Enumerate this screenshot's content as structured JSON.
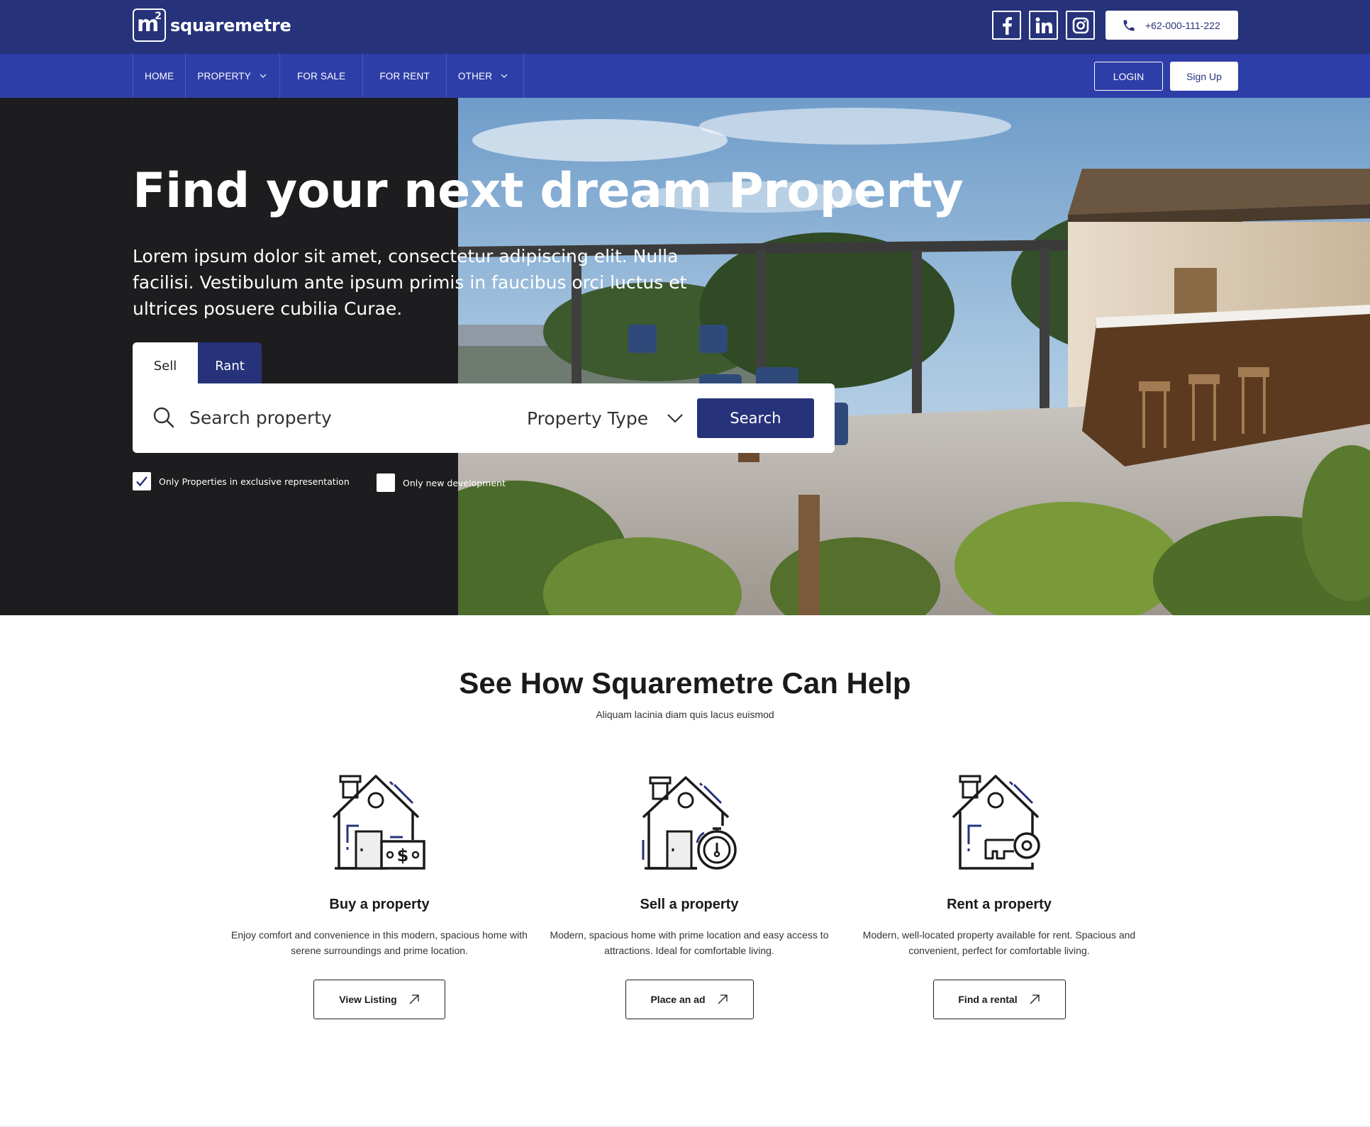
{
  "brand": {
    "logo_mark": "m",
    "logo_sup": "2",
    "name": "squaremetre",
    "primary_color": "#26337a",
    "nav_color": "#2e3ea8"
  },
  "topbar": {
    "social_icons": [
      "facebook-icon",
      "linkedin-icon",
      "instagram-icon"
    ],
    "phone": "+62-000-111-222"
  },
  "nav": {
    "items": [
      {
        "label": "HOME",
        "dropdown": false
      },
      {
        "label": "PROPERTY",
        "dropdown": true
      },
      {
        "label": "FOR SALE",
        "dropdown": false
      },
      {
        "label": "FOR RENT",
        "dropdown": false
      },
      {
        "label": "OTHER",
        "dropdown": true
      }
    ],
    "login": "LOGIN",
    "signup": "Sign Up"
  },
  "hero": {
    "title": "Find your next dream Property",
    "subtitle": "Lorem ipsum dolor sit amet, consectetur adipiscing elit. Nulla facilisi. Vestibulum ante ipsum primis in faucibus orci luctus et ultrices posuere cubilia Curae.",
    "tabs": [
      {
        "label": "Sell",
        "active": true
      },
      {
        "label": "Rant",
        "active": false
      }
    ],
    "search": {
      "placeholder": "Search property",
      "value": "",
      "property_type": "Property Type",
      "button": "Search"
    },
    "checkboxes": [
      {
        "label": "Only Properties in exclusive representation",
        "checked": true
      },
      {
        "label": "Only new development",
        "checked": false
      }
    ]
  },
  "help": {
    "title": "See How Squaremetre Can Help",
    "subtitle": "Aliquam lacinia diam quis lacus euismod",
    "cards": [
      {
        "icon": "house-money-icon",
        "title": "Buy a property",
        "desc": "Enjoy comfort and convenience in this modern, spacious home with serene surroundings and prime location.",
        "button": "View Listing"
      },
      {
        "icon": "house-timer-icon",
        "title": "Sell a property",
        "desc": "Modern, spacious home with prime location and easy access to attractions. Ideal for comfortable living.",
        "button": "Place an ad"
      },
      {
        "icon": "house-key-icon",
        "title": "Rent a property",
        "desc": "Modern, well-located property available for rent. Spacious and convenient, perfect for comfortable living.",
        "button": "Find a rental"
      }
    ]
  }
}
